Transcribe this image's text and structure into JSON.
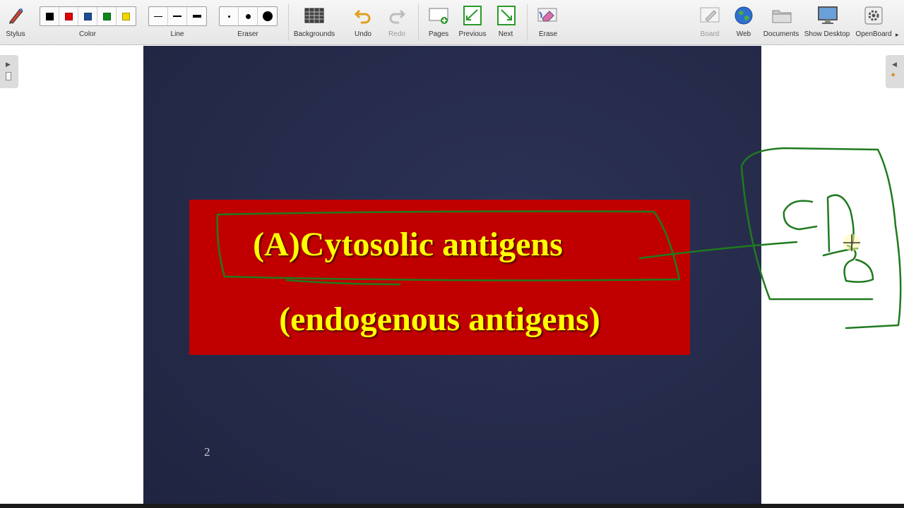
{
  "toolbar": {
    "stylus": "Stylus",
    "color": "Color",
    "line": "Line",
    "eraser": "Eraser",
    "backgrounds": "Backgrounds",
    "undo": "Undo",
    "redo": "Redo",
    "pages": "Pages",
    "previous": "Previous",
    "next": "Next",
    "erase": "Erase",
    "board": "Board",
    "web": "Web",
    "documents": "Documents",
    "show_desktop": "Show Desktop",
    "openboard": "OpenBoard",
    "colors": [
      "#000000",
      "#e00000",
      "#1a4f96",
      "#0a8a1a",
      "#f2d600"
    ]
  },
  "slide": {
    "line1": "(A)Cytosolic antigens",
    "line2": "(endogenous antigens)",
    "page_number": "2"
  },
  "ink_color": "#1f7a1f"
}
